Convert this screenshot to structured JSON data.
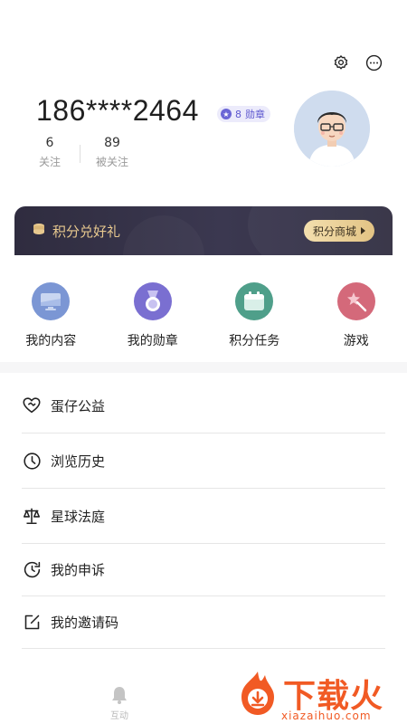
{
  "header": {
    "settings_icon": "gear-icon",
    "more_icon": "more-dots-icon"
  },
  "profile": {
    "phone": "186****2464",
    "badge": {
      "count": "8",
      "label": "勋章"
    },
    "following": {
      "count": "6",
      "label": "关注"
    },
    "followers": {
      "count": "89",
      "label": "被关注"
    }
  },
  "points_banner": {
    "title": "积分兑好礼",
    "button_label": "积分商城",
    "accent": "#e8c98f"
  },
  "quick_actions": [
    {
      "label": "我的内容",
      "icon": "monitor-icon",
      "color": "#7b96d4"
    },
    {
      "label": "我的勋章",
      "icon": "medal-icon",
      "color": "#7a6fd1"
    },
    {
      "label": "积分任务",
      "icon": "calendar-icon",
      "color": "#4f9f8a"
    },
    {
      "label": "游戏",
      "icon": "magic-wand-icon",
      "color": "#d4697a"
    }
  ],
  "menu": [
    {
      "label": "蛋仔公益",
      "icon": "heart-hand-icon"
    },
    {
      "label": "浏览历史",
      "icon": "clock-icon"
    },
    {
      "label": "星球法庭",
      "icon": "scales-icon"
    },
    {
      "label": "我的申诉",
      "icon": "history-icon"
    },
    {
      "label": "我的邀请码",
      "icon": "edit-icon"
    }
  ],
  "bottom_nav": {
    "label": "互动",
    "icon": "bell-icon"
  },
  "watermark": {
    "brand": "下载火",
    "url": "xiazaihuo.com"
  }
}
